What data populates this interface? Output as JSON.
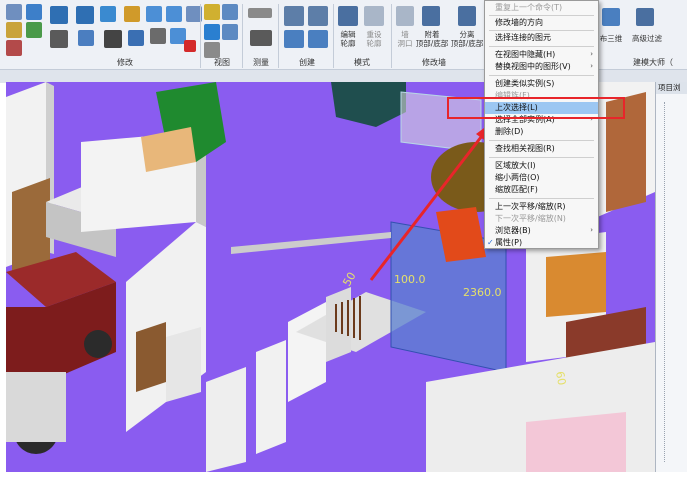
{
  "ribbon": {
    "panels": [
      {
        "label": "修改"
      },
      {
        "label": "视图"
      },
      {
        "label": "测量"
      },
      {
        "label": "创建"
      },
      {
        "label": "模式"
      },
      {
        "label": "修改墙"
      },
      {
        "label": "建模大师（"
      }
    ],
    "buttons": {
      "edit_profile": "编辑\n轮廓",
      "reset_profile": "重设\n轮廓",
      "wall_opening": "墙\n洞口",
      "attach_top_base": "附着\n顶部/底部",
      "detach": "分离\n顶部/底部",
      "split": "分离",
      "three_view": "布三维",
      "advanced_filter": "高级过滤"
    }
  },
  "context_menu": {
    "items": [
      {
        "label": "重复上一个命令(T)",
        "disabled": true
      },
      {
        "label": "修改墙的方向"
      },
      {
        "label": "选择连接的图元"
      },
      {
        "label": "在视图中隐藏(H)",
        "submenu": true
      },
      {
        "label": "替换视图中的图形(V)",
        "submenu": true
      },
      {
        "label": "创建类似实例(S)"
      },
      {
        "label": "编辑族(F)",
        "disabled": true
      },
      {
        "label": "上次选择(L)",
        "highlighted": true
      },
      {
        "label": "选择全部实例(A)",
        "submenu": true
      },
      {
        "label": "删除(D)"
      },
      {
        "label": "查找相关视图(R)"
      },
      {
        "label": "区域放大(I)"
      },
      {
        "label": "缩小两倍(O)"
      },
      {
        "label": "缩放匹配(F)"
      },
      {
        "label": "上一次平移/缩放(R)"
      },
      {
        "label": "下一次平移/缩放(N)",
        "disabled": true
      },
      {
        "label": "浏览器(B)",
        "submenu": true
      },
      {
        "label": "属性(P)",
        "checked": true
      }
    ],
    "submenu_arrow": "›",
    "check_mark": "✓"
  },
  "viewport": {
    "dimension_1": "100.0",
    "dimension_2": "2360.0",
    "dimension_3": "50",
    "dimension_4": "60"
  },
  "browser": {
    "title": "项目浏"
  },
  "colors": {
    "floor": "#8a5cf0",
    "highlight_box": "#e8252a",
    "menu_highlight": "#9cc7f2",
    "arrow": "#e8252a"
  }
}
